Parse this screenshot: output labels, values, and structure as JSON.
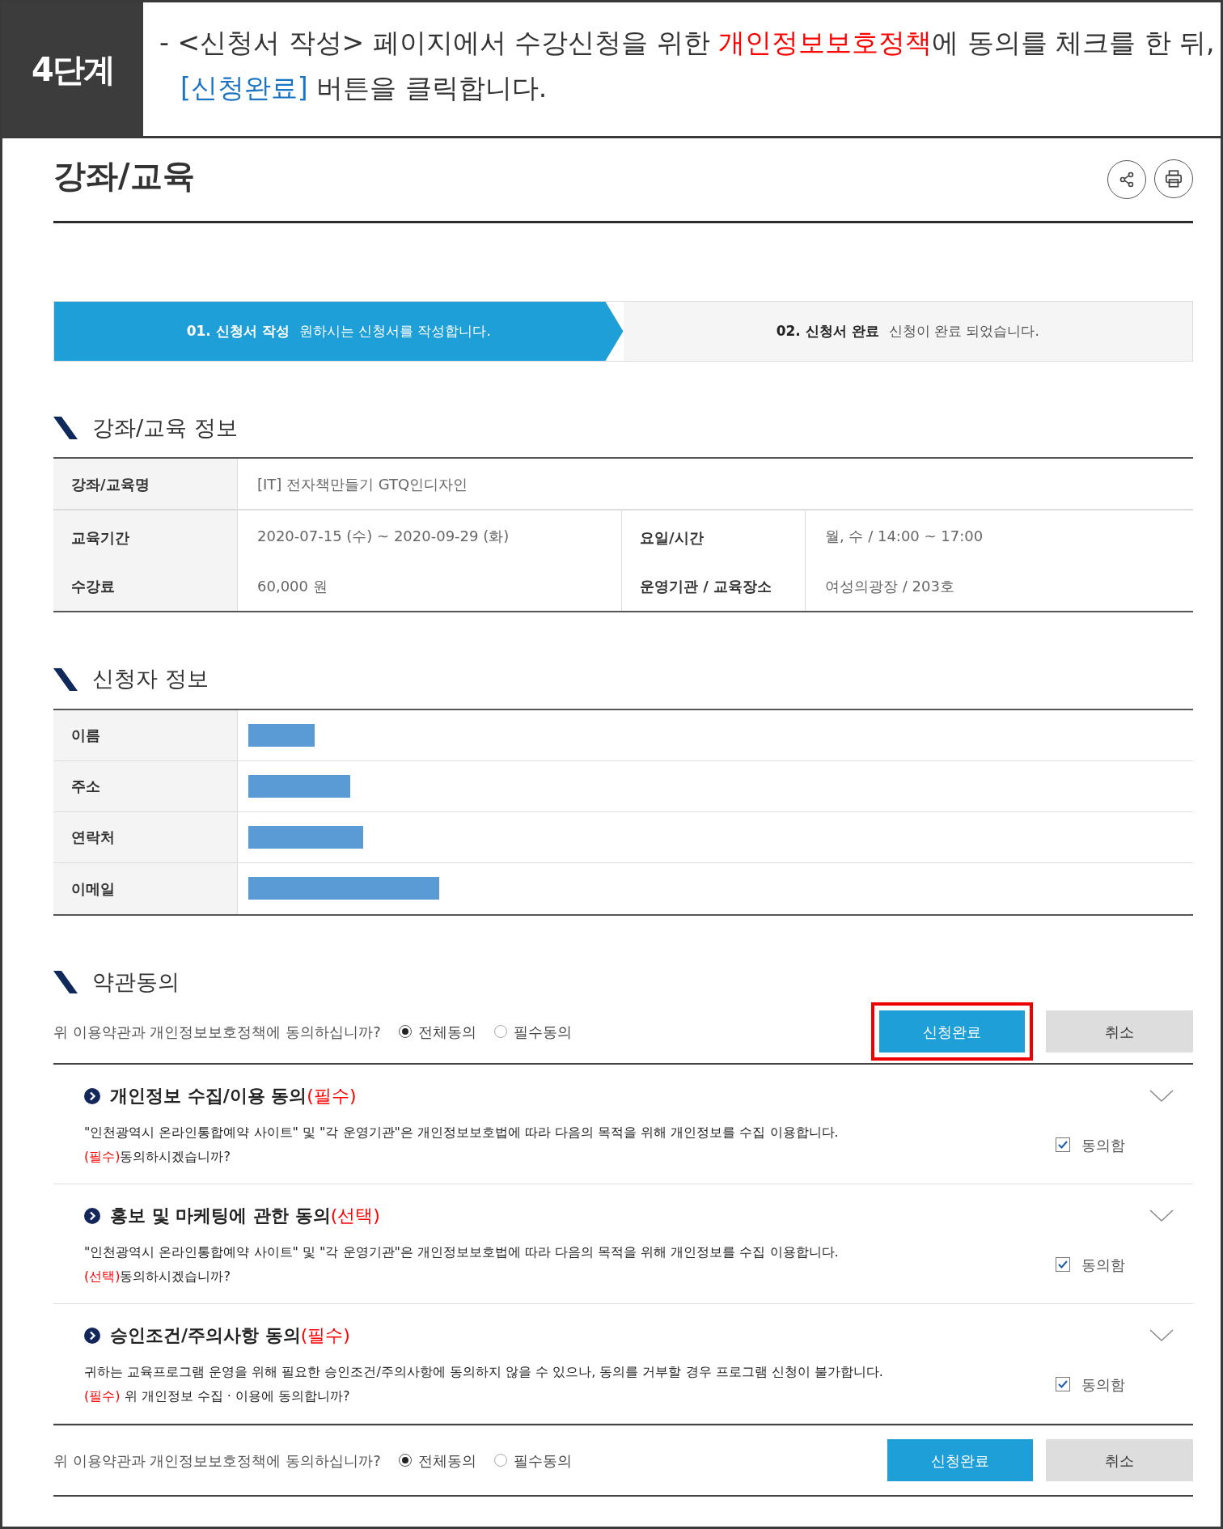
{
  "step_badge": "4단계",
  "instruction": {
    "lines": [
      [
        {
          "kind": "plain",
          "text": "- <신청서 작성> 페이지에서 수강신청을 위한 "
        },
        {
          "kind": "highlight",
          "text": "개인정보보호정책"
        },
        {
          "kind": "plain",
          "text": "에 동의를 체크를 한 뒤,"
        }
      ],
      [
        {
          "kind": "link",
          "text": "[신청완료]"
        },
        {
          "kind": "plain",
          "text": " 버튼을 클릭합니다."
        }
      ]
    ]
  },
  "page_title": "강좌/교육",
  "steps": [
    {
      "label": "01. 신청서 작성",
      "desc": "원하시는 신청서를 작성합니다.",
      "selected": true
    },
    {
      "label": "02. 신청서 완료",
      "desc": "신청이 완료 되었습니다.",
      "selected": false
    }
  ],
  "course_section": {
    "heading": "강좌/교육 정보",
    "name_label": "강좌/교육명",
    "name_value": "[IT] 전자책만들기 GTQ인디자인",
    "pairs": [
      [
        {
          "label": "교육기간",
          "value": "2020-07-15 (수) ~ 2020-09-29 (화)"
        },
        {
          "label": "요일/시간",
          "value": "월, 수 / 14:00 ~ 17:00"
        }
      ],
      [
        {
          "label": "수강료",
          "value": "60,000 원"
        },
        {
          "label": "운영기관 / 교육장소",
          "value": "여성의광장 / 203호"
        }
      ]
    ]
  },
  "applicant_section": {
    "heading": "신청자 정보",
    "fields": [
      {
        "label": "이름",
        "redacted": true
      },
      {
        "label": "주소",
        "redacted": true
      },
      {
        "label": "연락처",
        "redacted": true
      },
      {
        "label": "이메일",
        "redacted": true
      }
    ]
  },
  "terms_section": {
    "heading": "약관동의",
    "top_bar": {
      "question": "위 이용약관과 개인정보보호정책에 동의하십니까?",
      "options": [
        {
          "label": "전체동의",
          "selected": true
        },
        {
          "label": "필수동의",
          "selected": false
        }
      ],
      "submit": "신청완료",
      "cancel": "취소",
      "highlighted": true
    },
    "items": [
      {
        "title": "개인정보 수집/이용 동의",
        "tag": "(필수)",
        "text": "\"인천광역시 온라인통합예약 사이트\" 및 \"각 운영기관\"은 개인정보보호법에 따라 다음의 목적을 위해 개인정보를 수집 이용합니다.",
        "note_tag": "(필수)",
        "note": "동의하시겠습니까?",
        "agree_label": "동의함",
        "checked": true
      },
      {
        "title": "홍보 및 마케팅에 관한 동의",
        "tag": "(선택)",
        "text": "\"인천광역시 온라인통합예약 사이트\" 및 \"각 운영기관\"은 개인정보보호법에 따라 다음의 목적을 위해 개인정보를 수집 이용합니다.",
        "note_tag": "(선택)",
        "note": "동의하시겠습니까?",
        "agree_label": "동의함",
        "checked": true
      },
      {
        "title": "승인조건/주의사항 동의",
        "tag": "(필수)",
        "text": "귀하는 교육프로그램 운영을 위해 필요한 승인조건/주의사항에 동의하지 않을 수 있으나, 동의를 거부할 경우 프로그램 신청이 불가합니다.",
        "note_tag": "(필수)",
        "note": " 위 개인정보 수집 · 이용에 동의합니까?",
        "agree_label": "동의함",
        "checked": true
      }
    ],
    "bottom_bar": {
      "question": "위 이용약관과 개인정보보호정책에 동의하십니까?",
      "options": [
        {
          "label": "전체동의",
          "selected": true
        },
        {
          "label": "필수동의",
          "selected": false
        }
      ],
      "submit": "신청완료",
      "cancel": "취소"
    }
  }
}
